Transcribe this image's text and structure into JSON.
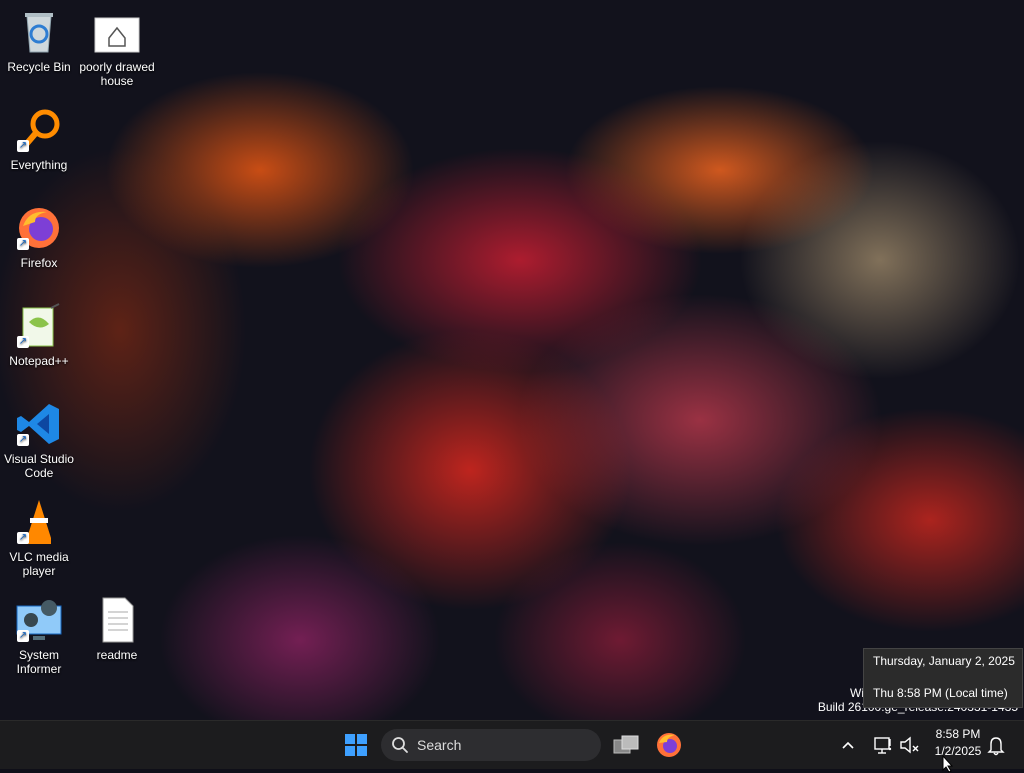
{
  "desktop": {
    "icons": [
      {
        "label": "Recycle Bin",
        "icon": "recycle-bin-icon"
      },
      {
        "label": "poorly drawed house",
        "icon": "image-file-icon"
      },
      {
        "label": "Everything",
        "icon": "everything-search-icon"
      },
      {
        "label": "Firefox",
        "icon": "firefox-icon"
      },
      {
        "label": "Notepad++",
        "icon": "notepadpp-icon"
      },
      {
        "label": "Visual Studio Code",
        "icon": "vscode-icon"
      },
      {
        "label": "VLC media player",
        "icon": "vlc-icon"
      },
      {
        "label": "System Informer",
        "icon": "system-informer-icon"
      },
      {
        "label": "readme",
        "icon": "text-file-icon"
      }
    ]
  },
  "watermark": {
    "line1": "Wi",
    "line2": "Build 26100.ge_release.240331-1435"
  },
  "tooltip": {
    "date_long": "Thursday, January 2, 2025",
    "time_local": "Thu 8:58 PM (Local time)"
  },
  "taskbar": {
    "search_label": "Search",
    "clock_time": "8:58 PM",
    "clock_date": "1/2/2025",
    "accent": "#1e88e5"
  }
}
